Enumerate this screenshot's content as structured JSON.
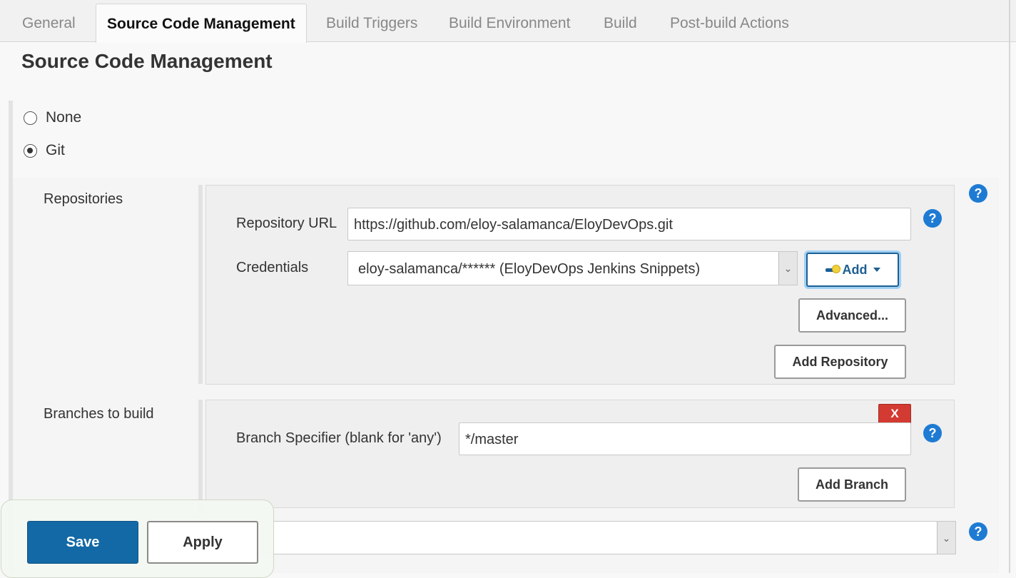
{
  "tabs": [
    {
      "label": "General"
    },
    {
      "label": "Source Code Management"
    },
    {
      "label": "Build Triggers"
    },
    {
      "label": "Build Environment"
    },
    {
      "label": "Build"
    },
    {
      "label": "Post-build Actions"
    }
  ],
  "section_title": "Source Code Management",
  "scm_options": [
    {
      "label": "None",
      "selected": false
    },
    {
      "label": "Git",
      "selected": true
    }
  ],
  "repositories": {
    "label": "Repositories",
    "repo_url_label": "Repository URL",
    "repo_url_value": "https://github.com/eloy-salamanca/EloyDevOps.git",
    "credentials_label": "Credentials",
    "credentials_value": "eloy-salamanca/****** (EloyDevOps Jenkins Snippets)",
    "add_label": "Add",
    "advanced_label": "Advanced...",
    "add_repository_label": "Add Repository"
  },
  "branches": {
    "label": "Branches to build",
    "specifier_label": "Branch Specifier (blank for 'any')",
    "specifier_value": "*/master",
    "delete_label": "X",
    "add_branch_label": "Add Branch"
  },
  "footer": {
    "save_label": "Save",
    "apply_label": "Apply"
  },
  "icons": {
    "help": "?",
    "dropdown": "⌄"
  },
  "colors": {
    "primary": "#1369a5",
    "help": "#1e7bd4",
    "delete": "#d33a31"
  }
}
